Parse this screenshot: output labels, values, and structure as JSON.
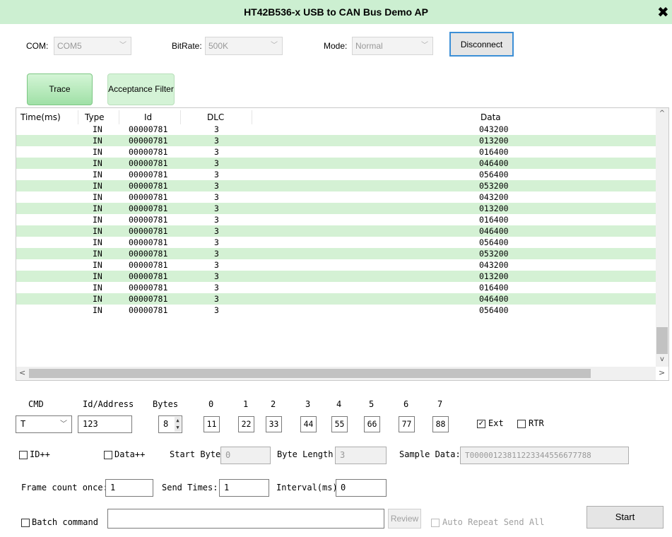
{
  "window": {
    "title": "HT42B536-x USB to CAN Bus Demo AP",
    "close_glyph": "✖"
  },
  "settings": {
    "com_label": "COM:",
    "com_value": "COM5",
    "bitrate_label": "BitRate:",
    "bitrate_value": "500K",
    "mode_label": "Mode:",
    "mode_value": "Normal",
    "disconnect_label": "Disconnect"
  },
  "tabs": [
    {
      "label": "Trace",
      "active": true
    },
    {
      "label": "Acceptance Filter",
      "active": false
    }
  ],
  "trace": {
    "columns": [
      "Time(ms)",
      "Type",
      "Id",
      "DLC",
      "Data"
    ],
    "rows": [
      [
        "",
        "IN",
        "00000781",
        "3",
        "043200"
      ],
      [
        "",
        "IN",
        "00000781",
        "3",
        "013200"
      ],
      [
        "",
        "IN",
        "00000781",
        "3",
        "016400"
      ],
      [
        "",
        "IN",
        "00000781",
        "3",
        "046400"
      ],
      [
        "",
        "IN",
        "00000781",
        "3",
        "056400"
      ],
      [
        "",
        "IN",
        "00000781",
        "3",
        "053200"
      ],
      [
        "",
        "IN",
        "00000781",
        "3",
        "043200"
      ],
      [
        "",
        "IN",
        "00000781",
        "3",
        "013200"
      ],
      [
        "",
        "IN",
        "00000781",
        "3",
        "016400"
      ],
      [
        "",
        "IN",
        "00000781",
        "3",
        "046400"
      ],
      [
        "",
        "IN",
        "00000781",
        "3",
        "056400"
      ],
      [
        "",
        "IN",
        "00000781",
        "3",
        "053200"
      ],
      [
        "",
        "IN",
        "00000781",
        "3",
        "043200"
      ],
      [
        "",
        "IN",
        "00000781",
        "3",
        "013200"
      ],
      [
        "",
        "IN",
        "00000781",
        "3",
        "016400"
      ],
      [
        "",
        "IN",
        "00000781",
        "3",
        "046400"
      ],
      [
        "",
        "IN",
        "00000781",
        "3",
        "056400"
      ]
    ],
    "scroll_up": "^",
    "scroll_down": "v",
    "scroll_left": "<",
    "scroll_right": ">"
  },
  "cmd": {
    "cmd_label": "CMD",
    "id_label": "Id/Address",
    "bytes_label": "Bytes",
    "byte_headers": [
      "0",
      "1",
      "2",
      "3",
      "4",
      "5",
      "6",
      "7"
    ],
    "cmd_value": "T",
    "id_value": "123",
    "bytes_value": "8",
    "byte_values": [
      "11",
      "22",
      "33",
      "44",
      "55",
      "66",
      "77",
      "88"
    ],
    "ext_label": "Ext",
    "ext_checked": true,
    "rtr_label": "RTR",
    "rtr_checked": false
  },
  "options": {
    "id_inc_label": "ID++",
    "data_inc_label": "Data++",
    "start_byte_label": "Start Byte:",
    "start_byte_value": "0",
    "byte_length_label": "Byte Length:",
    "byte_length_value": "3",
    "sample_data_label": "Sample Data:",
    "sample_data_value": "T00000123811223344556677788"
  },
  "send": {
    "frame_count_label": "Frame count once:",
    "frame_count_value": "1",
    "send_times_label": "Send Times:",
    "send_times_value": "1",
    "interval_label": "Interval(ms):",
    "interval_value": "0"
  },
  "batch": {
    "batch_label": "Batch command",
    "batch_value": "",
    "review_label": "Review",
    "auto_repeat_label": "Auto Repeat Send All",
    "start_label": "Start"
  },
  "colors": {
    "title_bg": "#ccefd1",
    "row_alt": "#d4f1d4",
    "tab_active": "#9fe0a6"
  }
}
